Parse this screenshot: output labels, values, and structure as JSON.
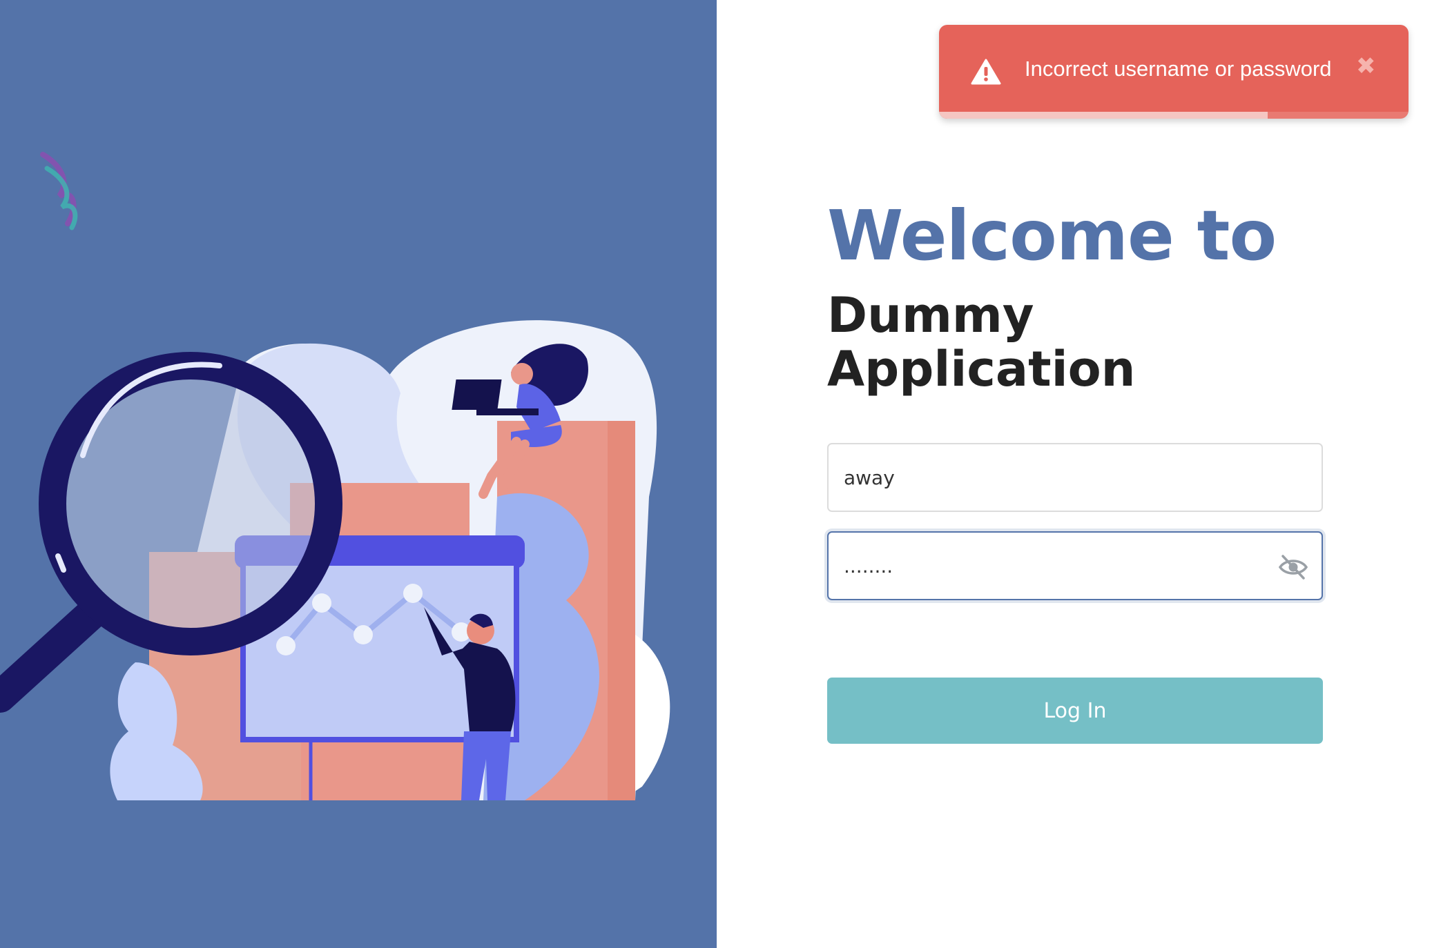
{
  "colors": {
    "left_panel_bg": "#5473a9",
    "title_accent": "#5473a9",
    "login_button_bg": "#75bfc6",
    "toast_bg": "#e5635a"
  },
  "heading": {
    "welcome": "Welcome to",
    "app_name_line1": "Dummy",
    "app_name_line2": "Application"
  },
  "form": {
    "username_value": "away",
    "password_value": "........",
    "password_visibility_icon": "eye-slash-icon",
    "login_label": "Log In"
  },
  "toast": {
    "icon": "warning-icon",
    "message": "Incorrect username or password",
    "close_glyph": "✖",
    "progress_remaining": 0.7
  }
}
